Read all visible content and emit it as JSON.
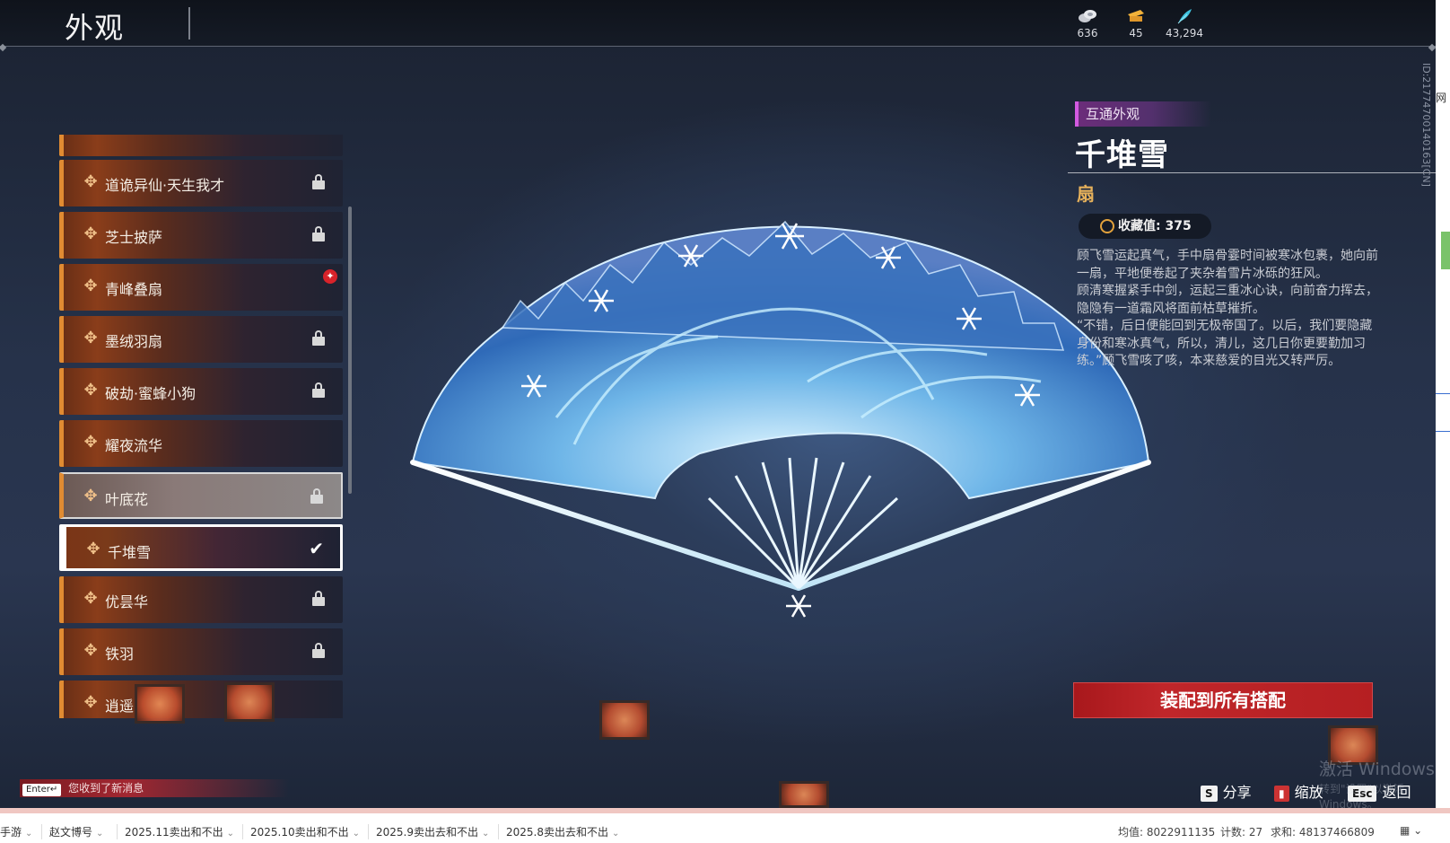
{
  "header": {
    "title": "外观",
    "currencies": [
      {
        "icon": "coin-stack-icon",
        "value": "636"
      },
      {
        "icon": "gold-ticket-icon",
        "value": "45"
      },
      {
        "icon": "feather-icon",
        "value": "43,294"
      }
    ]
  },
  "list": {
    "items": [
      {
        "label": "",
        "locked": false
      },
      {
        "label": "道诡异仙·天生我才",
        "locked": true
      },
      {
        "label": "芝士披萨",
        "locked": true
      },
      {
        "label": "青峰叠扇",
        "locked": false,
        "new": true
      },
      {
        "label": "墨绒羽扇",
        "locked": true
      },
      {
        "label": "破劫·蜜蜂小狗",
        "locked": true
      },
      {
        "label": "耀夜流华",
        "locked": false
      },
      {
        "label": "叶底花",
        "locked": true,
        "state": "hovered"
      },
      {
        "label": "千堆雪",
        "locked": false,
        "state": "selected"
      },
      {
        "label": "优昙华",
        "locked": true
      },
      {
        "label": "铁羽",
        "locked": true
      },
      {
        "label": "逍遥",
        "locked": false
      }
    ]
  },
  "detail": {
    "tag": "互通外观",
    "name": "千堆雪",
    "type": "扇",
    "collect_label": "收藏值: 375",
    "description": [
      "顾飞雪运起真气，手中扇骨霎时间被寒冰包裹，她向前一扇，平地便卷起了夹杂着雪片冰砾的狂风。",
      "顾清寒握紧手中剑，运起三重冰心诀，向前奋力挥去，隐隐有一道霜风将面前枯草摧折。",
      "“不错，后日便能回到无极帝国了。以后，我们要隐藏身份和寒冰真气，所以，清儿，这几日你更要勤加习练。”顾飞雪咳了咳，本来慈爱的目光又转严厉。"
    ],
    "equip_button": "装配到所有搭配",
    "side_id": "ID:2177470014016​3[CN]"
  },
  "footer": {
    "enter_key": "Enter↵",
    "message": "您收到了新消息",
    "hints": [
      {
        "key": "S",
        "label": "分享"
      },
      {
        "key": "🀫",
        "label": "缩放"
      },
      {
        "key": "Esc",
        "label": "返回"
      }
    ],
    "watermark": "激活 Windows",
    "watermark_sub": "转到\"设置\"以激活 Windows。"
  },
  "sheet": {
    "tabs": [
      "手游",
      "赵文博号",
      "2025.11卖出和不出",
      "2025.10卖出和不出",
      "2025.9卖出去和不出",
      "2025.8卖出去和不出"
    ],
    "stats": {
      "avg": "均值: 8022911135",
      "count": "计数: 27",
      "sum": "求和: 48137466809"
    }
  },
  "side_text": "网"
}
